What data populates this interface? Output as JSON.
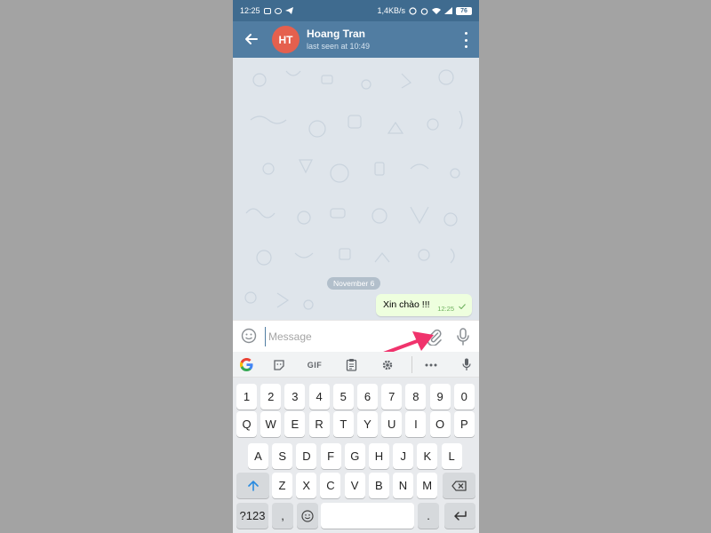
{
  "status_bar": {
    "time": "12:25",
    "network_speed": "1,4KB/s",
    "battery": "76"
  },
  "chat_header": {
    "avatar_initials": "HT",
    "avatar_color": "#e5604e",
    "contact_name": "Hoang Tran",
    "last_seen": "last seen at 10:49",
    "header_color": "#517da2"
  },
  "chat": {
    "date_separator": "November 6",
    "messages": [
      {
        "text": "Xin chào !!!",
        "time": "12:25",
        "outgoing": true,
        "status": "sent-check"
      }
    ]
  },
  "input_bar": {
    "placeholder": "Message",
    "icons": [
      "smile-icon",
      "paperclip-icon",
      "microphone-icon"
    ],
    "annotation_arrow_color": "#f0336c"
  },
  "keyboard_toolbar": {
    "icons": [
      "google-icon",
      "sticker-icon",
      "gif-icon",
      "clipboard-icon",
      "gear-icon",
      "more-icon",
      "microphone-icon"
    ],
    "gif_label": "GIF"
  },
  "keyboard": {
    "row_numbers": [
      "1",
      "2",
      "3",
      "4",
      "5",
      "6",
      "7",
      "8",
      "9",
      "0"
    ],
    "row_1": [
      "Q",
      "W",
      "E",
      "R",
      "T",
      "Y",
      "U",
      "I",
      "O",
      "P"
    ],
    "row_2": [
      "A",
      "S",
      "D",
      "F",
      "G",
      "H",
      "J",
      "K",
      "L"
    ],
    "row_3": [
      "Z",
      "X",
      "C",
      "V",
      "B",
      "N",
      "M"
    ],
    "symbols_key": "?123",
    "comma_key": ",",
    "period_key": "."
  }
}
